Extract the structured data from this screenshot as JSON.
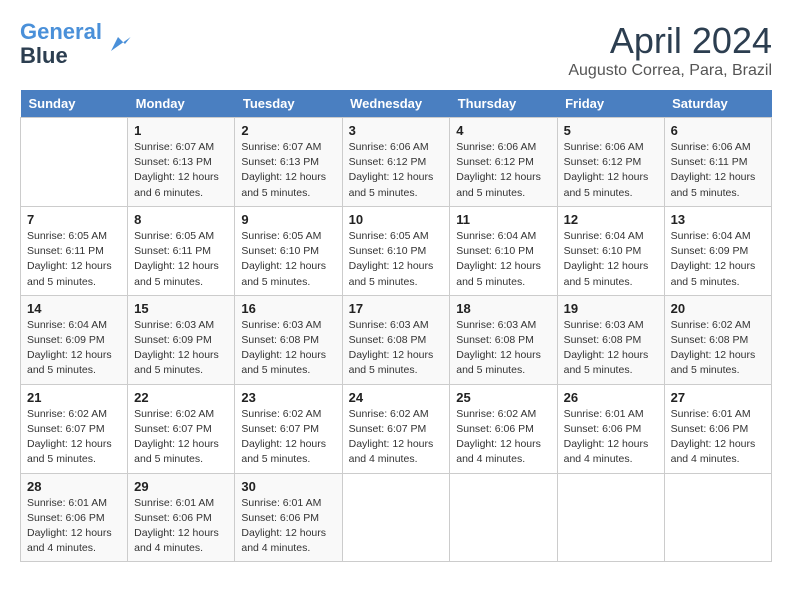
{
  "header": {
    "logo_line1": "General",
    "logo_line2": "Blue",
    "title": "April 2024",
    "location": "Augusto Correa, Para, Brazil"
  },
  "days_of_week": [
    "Sunday",
    "Monday",
    "Tuesday",
    "Wednesday",
    "Thursday",
    "Friday",
    "Saturday"
  ],
  "weeks": [
    [
      {
        "num": "",
        "info": ""
      },
      {
        "num": "1",
        "info": "Sunrise: 6:07 AM\nSunset: 6:13 PM\nDaylight: 12 hours\nand 6 minutes."
      },
      {
        "num": "2",
        "info": "Sunrise: 6:07 AM\nSunset: 6:13 PM\nDaylight: 12 hours\nand 5 minutes."
      },
      {
        "num": "3",
        "info": "Sunrise: 6:06 AM\nSunset: 6:12 PM\nDaylight: 12 hours\nand 5 minutes."
      },
      {
        "num": "4",
        "info": "Sunrise: 6:06 AM\nSunset: 6:12 PM\nDaylight: 12 hours\nand 5 minutes."
      },
      {
        "num": "5",
        "info": "Sunrise: 6:06 AM\nSunset: 6:12 PM\nDaylight: 12 hours\nand 5 minutes."
      },
      {
        "num": "6",
        "info": "Sunrise: 6:06 AM\nSunset: 6:11 PM\nDaylight: 12 hours\nand 5 minutes."
      }
    ],
    [
      {
        "num": "7",
        "info": "Sunrise: 6:05 AM\nSunset: 6:11 PM\nDaylight: 12 hours\nand 5 minutes."
      },
      {
        "num": "8",
        "info": "Sunrise: 6:05 AM\nSunset: 6:11 PM\nDaylight: 12 hours\nand 5 minutes."
      },
      {
        "num": "9",
        "info": "Sunrise: 6:05 AM\nSunset: 6:10 PM\nDaylight: 12 hours\nand 5 minutes."
      },
      {
        "num": "10",
        "info": "Sunrise: 6:05 AM\nSunset: 6:10 PM\nDaylight: 12 hours\nand 5 minutes."
      },
      {
        "num": "11",
        "info": "Sunrise: 6:04 AM\nSunset: 6:10 PM\nDaylight: 12 hours\nand 5 minutes."
      },
      {
        "num": "12",
        "info": "Sunrise: 6:04 AM\nSunset: 6:10 PM\nDaylight: 12 hours\nand 5 minutes."
      },
      {
        "num": "13",
        "info": "Sunrise: 6:04 AM\nSunset: 6:09 PM\nDaylight: 12 hours\nand 5 minutes."
      }
    ],
    [
      {
        "num": "14",
        "info": "Sunrise: 6:04 AM\nSunset: 6:09 PM\nDaylight: 12 hours\nand 5 minutes."
      },
      {
        "num": "15",
        "info": "Sunrise: 6:03 AM\nSunset: 6:09 PM\nDaylight: 12 hours\nand 5 minutes."
      },
      {
        "num": "16",
        "info": "Sunrise: 6:03 AM\nSunset: 6:08 PM\nDaylight: 12 hours\nand 5 minutes."
      },
      {
        "num": "17",
        "info": "Sunrise: 6:03 AM\nSunset: 6:08 PM\nDaylight: 12 hours\nand 5 minutes."
      },
      {
        "num": "18",
        "info": "Sunrise: 6:03 AM\nSunset: 6:08 PM\nDaylight: 12 hours\nand 5 minutes."
      },
      {
        "num": "19",
        "info": "Sunrise: 6:03 AM\nSunset: 6:08 PM\nDaylight: 12 hours\nand 5 minutes."
      },
      {
        "num": "20",
        "info": "Sunrise: 6:02 AM\nSunset: 6:08 PM\nDaylight: 12 hours\nand 5 minutes."
      }
    ],
    [
      {
        "num": "21",
        "info": "Sunrise: 6:02 AM\nSunset: 6:07 PM\nDaylight: 12 hours\nand 5 minutes."
      },
      {
        "num": "22",
        "info": "Sunrise: 6:02 AM\nSunset: 6:07 PM\nDaylight: 12 hours\nand 5 minutes."
      },
      {
        "num": "23",
        "info": "Sunrise: 6:02 AM\nSunset: 6:07 PM\nDaylight: 12 hours\nand 5 minutes."
      },
      {
        "num": "24",
        "info": "Sunrise: 6:02 AM\nSunset: 6:07 PM\nDaylight: 12 hours\nand 4 minutes."
      },
      {
        "num": "25",
        "info": "Sunrise: 6:02 AM\nSunset: 6:06 PM\nDaylight: 12 hours\nand 4 minutes."
      },
      {
        "num": "26",
        "info": "Sunrise: 6:01 AM\nSunset: 6:06 PM\nDaylight: 12 hours\nand 4 minutes."
      },
      {
        "num": "27",
        "info": "Sunrise: 6:01 AM\nSunset: 6:06 PM\nDaylight: 12 hours\nand 4 minutes."
      }
    ],
    [
      {
        "num": "28",
        "info": "Sunrise: 6:01 AM\nSunset: 6:06 PM\nDaylight: 12 hours\nand 4 minutes."
      },
      {
        "num": "29",
        "info": "Sunrise: 6:01 AM\nSunset: 6:06 PM\nDaylight: 12 hours\nand 4 minutes."
      },
      {
        "num": "30",
        "info": "Sunrise: 6:01 AM\nSunset: 6:06 PM\nDaylight: 12 hours\nand 4 minutes."
      },
      {
        "num": "",
        "info": ""
      },
      {
        "num": "",
        "info": ""
      },
      {
        "num": "",
        "info": ""
      },
      {
        "num": "",
        "info": ""
      }
    ]
  ]
}
